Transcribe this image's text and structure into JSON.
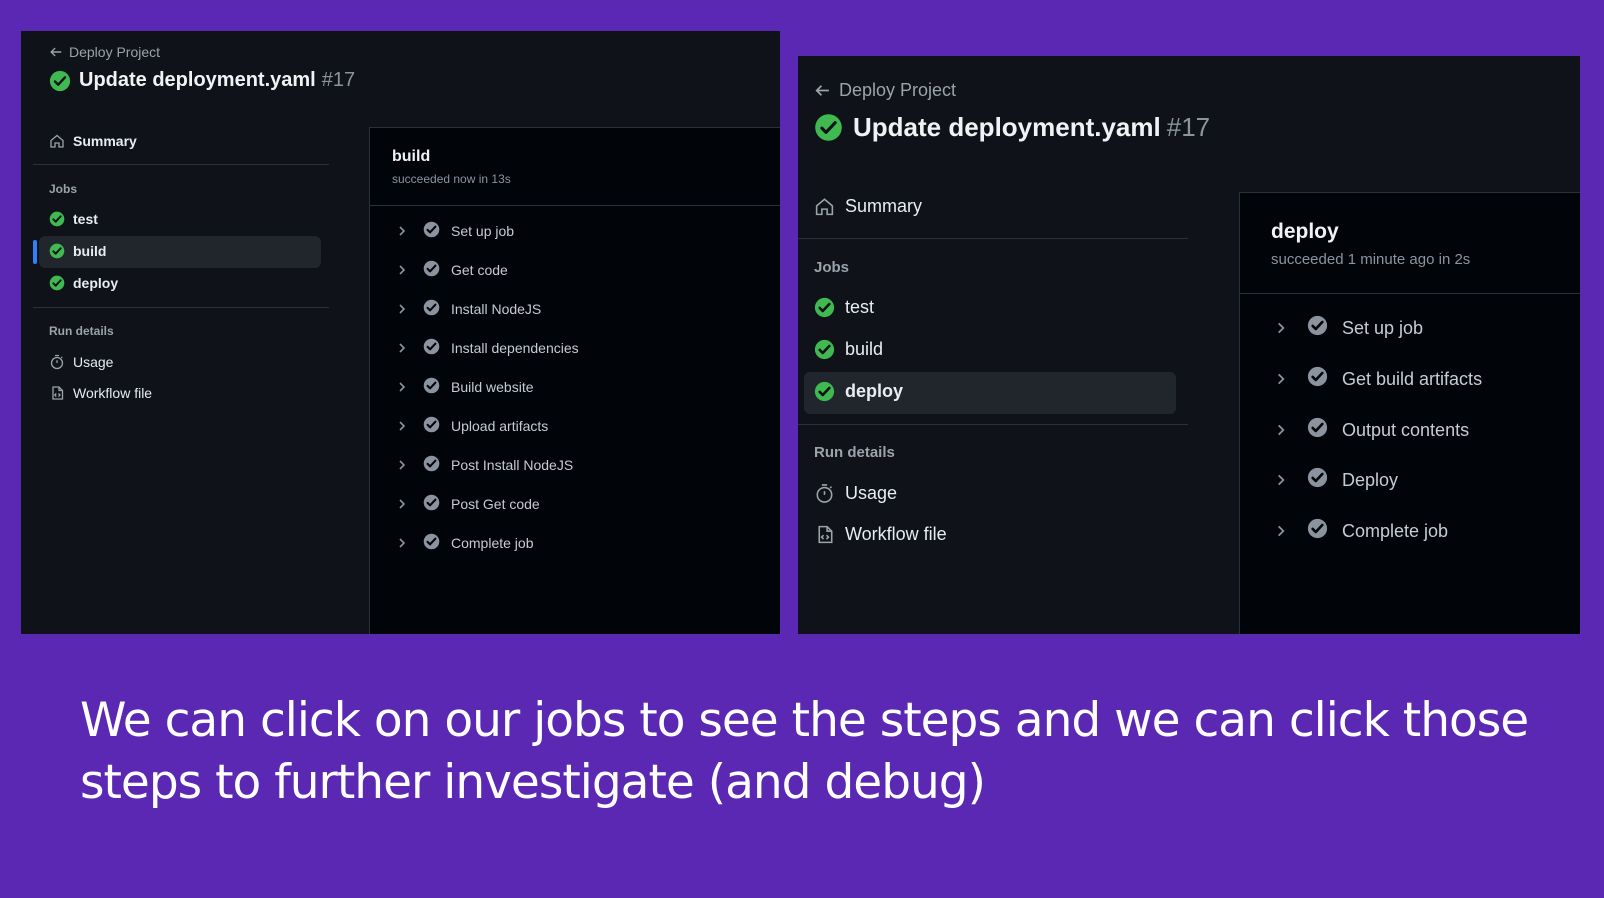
{
  "left": {
    "back_label": "Deploy Project",
    "title": "Update deployment.yaml",
    "run_number": "#17",
    "summary_label": "Summary",
    "jobs_heading": "Jobs",
    "jobs": [
      "test",
      "build",
      "deploy"
    ],
    "selected_job": "build",
    "run_details_heading": "Run details",
    "usage_label": "Usage",
    "workflow_file_label": "Workflow file",
    "panel_title": "build",
    "panel_status": "succeeded now in 13s",
    "steps": [
      "Set up job",
      "Get code",
      "Install NodeJS",
      "Install dependencies",
      "Build website",
      "Upload artifacts",
      "Post Install NodeJS",
      "Post Get code",
      "Complete job"
    ]
  },
  "right": {
    "back_label": "Deploy Project",
    "title": "Update deployment.yaml",
    "run_number": "#17",
    "summary_label": "Summary",
    "jobs_heading": "Jobs",
    "jobs": [
      "test",
      "build",
      "deploy"
    ],
    "selected_job": "deploy",
    "run_details_heading": "Run details",
    "usage_label": "Usage",
    "workflow_file_label": "Workflow file",
    "panel_title": "deploy",
    "panel_status": "succeeded 1 minute ago in 2s",
    "steps": [
      "Set up job",
      "Get build artifacts",
      "Output contents",
      "Deploy",
      "Complete job"
    ]
  },
  "caption": "We can click on our jobs to see the steps and we can click those steps to further investigate (and debug)",
  "colors": {
    "background": "#5b28b4",
    "success": "#3fb950",
    "accent": "#2f81f7",
    "step_check": "#8b949e"
  }
}
